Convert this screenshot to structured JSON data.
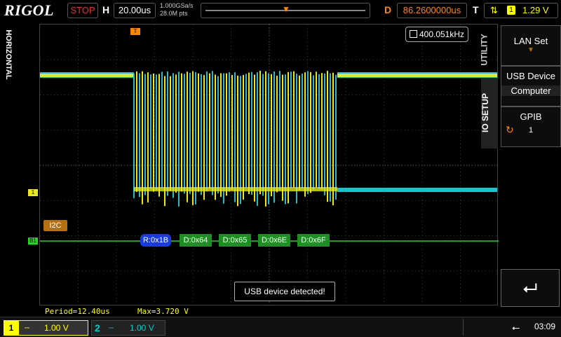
{
  "brand": "RIGOL",
  "top": {
    "run_state": "STOP",
    "h_label": "H",
    "timebase": "20.00us",
    "sample_rate": "1.000GSa/s",
    "memory_depth": "28.0M pts",
    "d_label": "D",
    "delay": "86.2600000us",
    "t_label": "T",
    "trigger_source": "1",
    "trigger_level": "1.29 V"
  },
  "left_tab": "HORIZONTAL",
  "frequency": "400.051kHz",
  "decoder_label": "I2C",
  "channel_marker_1": "1",
  "channel_marker_bus": "B1",
  "packets": [
    {
      "text": "R:0x1B",
      "kind": "read"
    },
    {
      "text": "D:0x64",
      "kind": "data"
    },
    {
      "text": "D:0x65",
      "kind": "data"
    },
    {
      "text": "D:0x6E",
      "kind": "data"
    },
    {
      "text": "D:0x6F",
      "kind": "data"
    }
  ],
  "message": "USB device detected!",
  "measurements": {
    "period": "Period=12.40us",
    "max": "Max=3.720 V"
  },
  "menu": {
    "lan_set": "LAN Set",
    "usb_device": "USB Device",
    "usb_value": "Computer",
    "gpib": "GPIB",
    "gpib_value": "1",
    "utility_tab": "UTILITY",
    "io_tab": "IO SETUP"
  },
  "bottom": {
    "ch1_num": "1",
    "ch1_scale": "1.00 V",
    "ch2_num": "2",
    "ch2_scale": "1.00 V",
    "time": "03:09"
  },
  "colors": {
    "ch1": "#e8e81a",
    "ch2": "#18c4cc",
    "bus": "#2bd02b",
    "trigger": "#ff8800"
  }
}
